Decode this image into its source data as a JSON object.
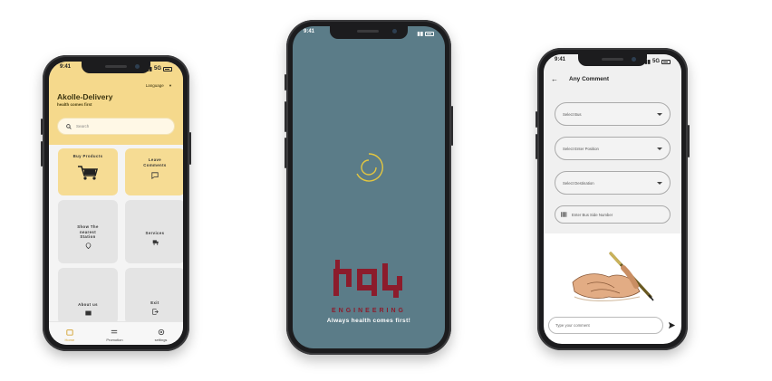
{
  "status": {
    "time": "9:41",
    "network": "5G"
  },
  "home": {
    "app_title": "Akolle-Delivery",
    "tagline": "health comes first",
    "language_label": "Language",
    "search_placeholder": "Search",
    "accent_color": "#f5d98c",
    "tiles": [
      {
        "label": "Buy Products",
        "icon": "cart-icon"
      },
      {
        "label": "Leave Comments",
        "icon": "comment-icon"
      },
      {
        "label": "Show The nearest Station",
        "icon": "map-pin-icon"
      },
      {
        "label": "Services",
        "icon": "truck-icon"
      },
      {
        "label": "About us",
        "icon": "info-card-icon"
      },
      {
        "label": "Exit",
        "icon": "logout-icon"
      }
    ],
    "nav": [
      {
        "label": "Home",
        "icon": "home-icon"
      },
      {
        "label": "Promotion",
        "icon": "menu-icon"
      },
      {
        "label": "settings",
        "icon": "gear-icon"
      }
    ]
  },
  "splash": {
    "logo_glyphs": "ኣኮሌ",
    "logo_subtitle": "ENGINEERING",
    "tagline": "Always health comes first!",
    "background_color": "#5b7c88",
    "logo_color": "#8c1c2c"
  },
  "comment": {
    "title": "Any Comment",
    "select_bus": "Select Bus",
    "select_position": "Select Enter Position",
    "select_destination": "Select Destination",
    "side_number_placeholder": "Enter Bus Side Number",
    "comment_placeholder": "Type your comment"
  }
}
